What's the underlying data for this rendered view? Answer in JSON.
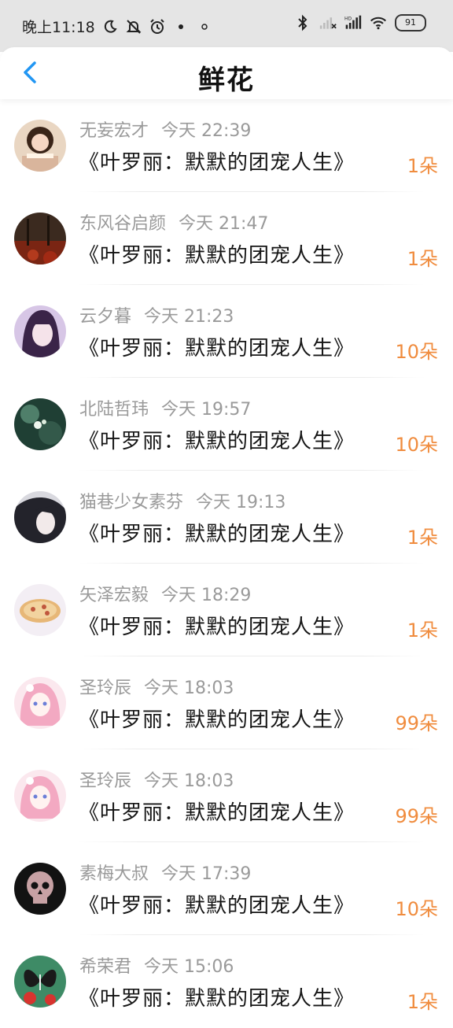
{
  "status_bar": {
    "time": "晚上11:18",
    "battery": "91",
    "icons": [
      "moon-icon",
      "mute-icon",
      "alarm-icon",
      "dot-icon",
      "dot-icon",
      "bluetooth-icon",
      "signal-icon",
      "hd-signal-icon",
      "wifi-icon",
      "battery-icon"
    ]
  },
  "header": {
    "title": "鲜花",
    "back_icon": "chevron-left-icon"
  },
  "colors": {
    "accent": "#2196f3",
    "count": "#f08c3e",
    "meta_text": "#9a9a9a",
    "primary_text": "#151515"
  },
  "items": [
    {
      "name": "无妄宏才",
      "time": "今天 22:39",
      "book": "《叶罗丽：默默的团宠人生》",
      "count": "1朵",
      "avatar": "girl-photo"
    },
    {
      "name": "东风谷启颜",
      "time": "今天 21:47",
      "book": "《叶罗丽：默默的团宠人生》",
      "count": "1朵",
      "avatar": "autumn-forest"
    },
    {
      "name": "云夕暮",
      "time": "今天 21:23",
      "book": "《叶罗丽：默默的团宠人生》",
      "count": "10朵",
      "avatar": "purple-anime-girl"
    },
    {
      "name": "北陆哲玮",
      "time": "今天 19:57",
      "book": "《叶罗丽：默默的团宠人生》",
      "count": "10朵",
      "avatar": "green-dew"
    },
    {
      "name": "猫巷少女素芬",
      "time": "今天 19:13",
      "book": "《叶罗丽：默默的团宠人生》",
      "count": "1朵",
      "avatar": "dark-hair-girl"
    },
    {
      "name": "矢泽宏毅",
      "time": "今天 18:29",
      "book": "《叶罗丽：默默的团宠人生》",
      "count": "1朵",
      "avatar": "pizza"
    },
    {
      "name": "圣玲辰",
      "time": "今天 18:03",
      "book": "《叶罗丽：默默的团宠人生》",
      "count": "99朵",
      "avatar": "pink-anime-girl"
    },
    {
      "name": "圣玲辰",
      "time": "今天 18:03",
      "book": "《叶罗丽：默默的团宠人生》",
      "count": "99朵",
      "avatar": "pink-anime-girl"
    },
    {
      "name": "素梅大叔",
      "time": "今天 17:39",
      "book": "《叶罗丽：默默的团宠人生》",
      "count": "10朵",
      "avatar": "floral-skull"
    },
    {
      "name": "希荣君",
      "time": "今天 15:06",
      "book": "《叶罗丽：默默的团宠人生》",
      "count": "1朵",
      "avatar": "butterfly"
    }
  ]
}
